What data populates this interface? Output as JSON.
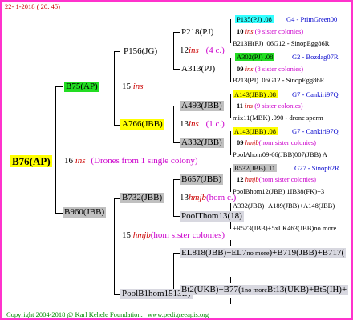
{
  "header": {
    "date": "22- 1-2018 ( 20: 45)"
  },
  "footer": {
    "copyright": "Copyright 2004-2018 @ Karl Kehele Foundation.",
    "url": "www.pedigreeapis.org"
  },
  "root": {
    "name": "B76(AP)",
    "year": "16",
    "ins": "ins",
    "note": "(Drones from 1 single colony)"
  },
  "gen1": {
    "top": {
      "name": "B75(AP)",
      "year": "15",
      "ins": "ins"
    },
    "bottom": {
      "name": "B960(JBB)",
      "year": "15",
      "ins": "hmjb",
      "note": "(hom sister colonies)"
    }
  },
  "gen2": {
    "a": {
      "name": "P156(JG)",
      "year": "12",
      "ins": "ins",
      "note": "(4 c.)"
    },
    "b": {
      "name": "A766(JBB)",
      "year": "13",
      "ins": "ins",
      "note": "(1 c.)"
    },
    "c": {
      "name": "B732(JBB)",
      "year": "13",
      "ins": "hmjb",
      "note": "(hom c.)"
    },
    "d": {
      "name": "PoolB1hom15",
      "year": "13",
      "suffix": "B)"
    }
  },
  "gen3": {
    "a1": "P218(PJ)",
    "a2": "A313(PJ)",
    "b1": "A493(JBB)",
    "b2": "A332(JBB)",
    "c1": "B657(JBB)",
    "c2": "PoolThom13(",
    "c2b": "18)",
    "d1": "EL818(JBB)+EL7",
    "d1b": "no more",
    "d1c": ")+B719(JBB)+B717(",
    "d2": "Bt2(UKB)+B77(",
    "d2b": "1no more",
    "d2c": "Bt13(UKB)+Bt5(IH)+"
  },
  "gen4": [
    {
      "name": "P135(PJ) .08",
      "info": "G4 - PrimGreen00",
      "year": "10",
      "ins": "ins",
      "note": "(9 sister colonies)",
      "sub": "B213H(PJ) .06G12 - SinopEgg86R"
    },
    {
      "name": "A302(PJ) .08",
      "info": "G2 - Bozdag07R",
      "year": "09",
      "ins": "ins",
      "note": "(8 sister colonies)",
      "sub": "B213(PJ) .06G12 - SinopEgg86R"
    },
    {
      "name": "A143(JBB) .08",
      "info": "G7 - Cankiri97Q",
      "year": "11",
      "ins": "ins",
      "note": "(9 sister colonies)",
      "sub": "mix11(MBK) .090 - drone sperm"
    },
    {
      "name": "A143(JBB) .08",
      "info": "G7 - Cankiri97Q",
      "year": "09",
      "ins": "hmjb",
      "note": "(hom sister colonies)",
      "sub": "PoolAhom09-66(JBB)007(JBB) A"
    },
    {
      "name": "B532(JBB) .11",
      "info": "G27 - Sinop62R",
      "year": "12",
      "ins": "hmjb",
      "note": "(hom sister colonies)",
      "sub": "PoolBhom12(JBB) 1IB38(FK)+3"
    },
    {
      "sub": "A332(JBB)+A189(JBB)+A148(JBB)"
    },
    {
      "sub": "+R573(JBB)+5xLK463(JBB)no more"
    }
  ],
  "colors": {
    "border": "#ff33cc",
    "green": "#22dd22",
    "yellow": "#ffff00",
    "gray": "#c0c0c0",
    "cyan": "#33ffff"
  }
}
